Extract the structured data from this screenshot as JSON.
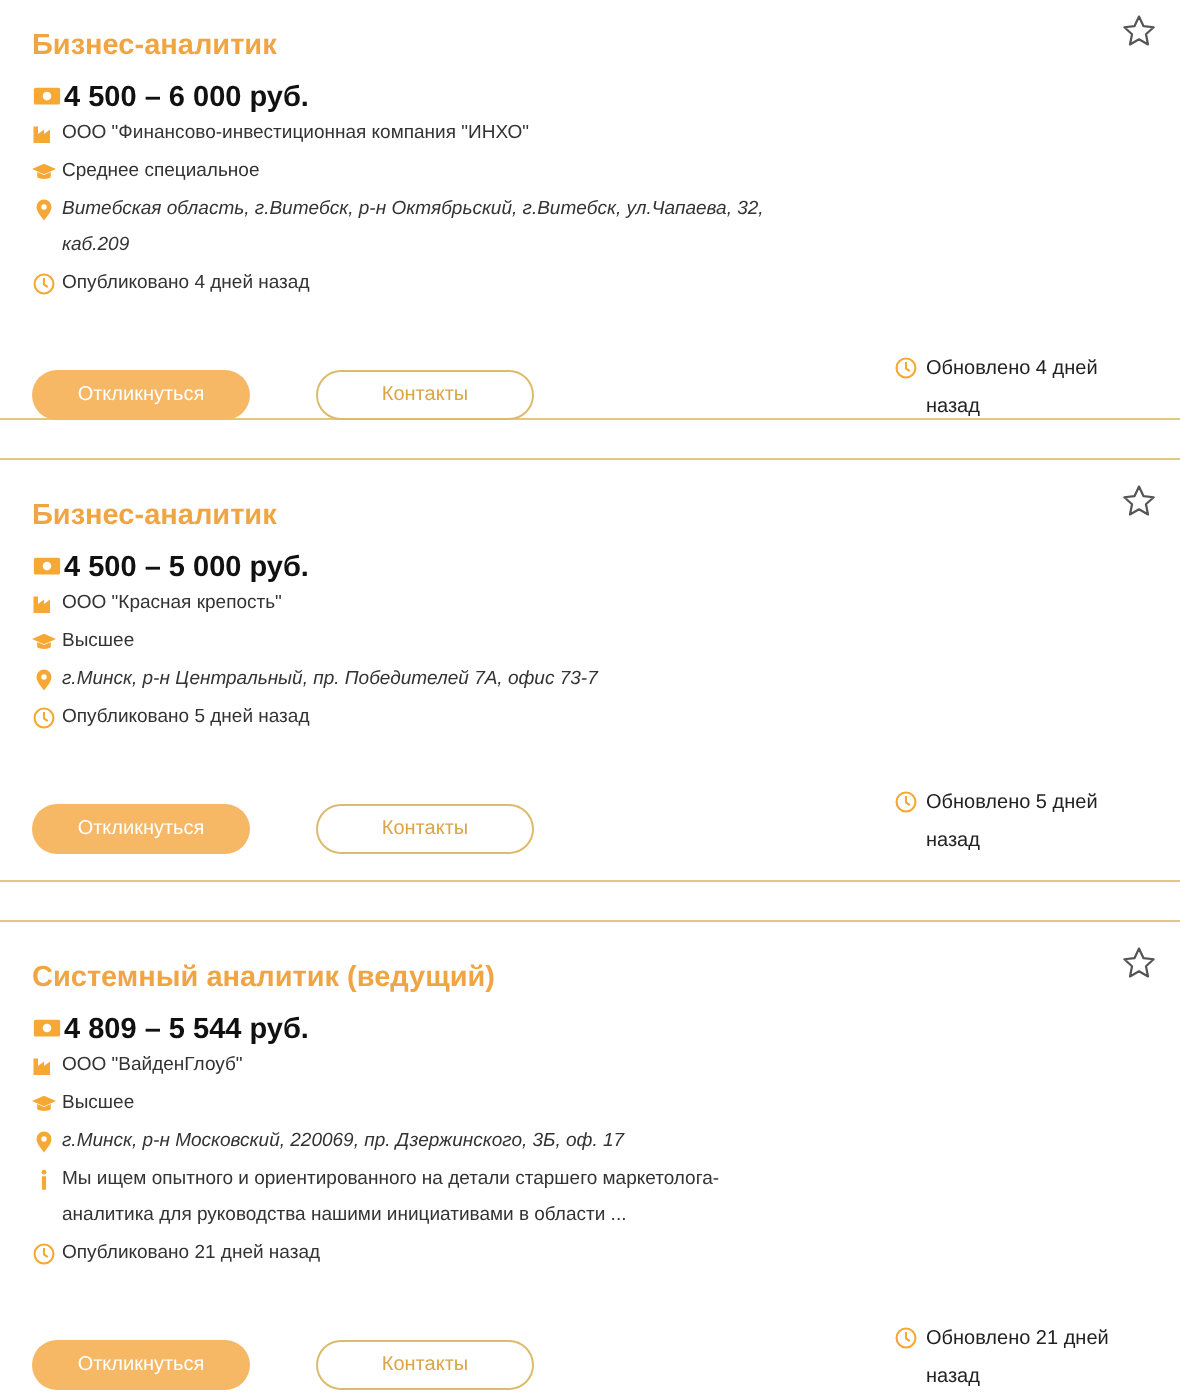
{
  "vacancies": [
    {
      "title": "Бизнес-аналитик",
      "starred": false,
      "salary": "4 500 – 6 000 руб.",
      "details": [
        {
          "kind": "company",
          "text": "ООО \"Финансово-инвестиционная компания \"ИНХО\""
        },
        {
          "kind": "education",
          "text": "Среднее специальное"
        },
        {
          "kind": "address",
          "text": "Витебская область, г.Витебск, р-н Октябрьский, г.Витебск, ул.Чапаева, 32, каб.209"
        },
        {
          "kind": "published",
          "text": "Опубликовано 4 дней назад"
        }
      ],
      "buttons": [
        {
          "kind": "primary",
          "label": "Откликнуться"
        },
        {
          "kind": "secondary",
          "label": "Контакты"
        }
      ],
      "updated": "Обновлено 4 дней назад"
    },
    {
      "title": "Бизнес-аналитик",
      "starred": false,
      "salary": "4 500 – 5 000 руб.",
      "details": [
        {
          "kind": "company",
          "text": "ООО \"Красная крепость\""
        },
        {
          "kind": "education",
          "text": "Высшее"
        },
        {
          "kind": "address",
          "text": "г.Минск, р-н Центральный, пр. Победителей 7А, офис 73-7"
        },
        {
          "kind": "published",
          "text": "Опубликовано 5 дней назад"
        }
      ],
      "buttons": [
        {
          "kind": "primary",
          "label": "Откликнуться"
        },
        {
          "kind": "secondary",
          "label": "Контакты"
        }
      ],
      "updated": "Обновлено 5 дней назад"
    },
    {
      "title": "Системный аналитик (ведущий)",
      "starred": false,
      "salary": "4 809 – 5 544 руб.",
      "details": [
        {
          "kind": "company",
          "text": "ООО \"ВайденГлоуб\""
        },
        {
          "kind": "education",
          "text": "Высшее"
        },
        {
          "kind": "address",
          "text": "г.Минск, р-н Московский, 220069, пр. Дзержинского, 3Б, оф. 17"
        },
        {
          "kind": "description",
          "text": "Мы ищем опытного и ориентированного на детали старшего маркетолога-аналитика для руководства нашими инициативами в области ..."
        },
        {
          "kind": "published",
          "text": "Опубликовано 21 дней назад"
        }
      ],
      "buttons": [
        {
          "kind": "primary",
          "label": "Откликнуться"
        },
        {
          "kind": "secondary",
          "label": "Контакты"
        }
      ],
      "updated": "Обновлено 21 дней назад"
    }
  ]
}
